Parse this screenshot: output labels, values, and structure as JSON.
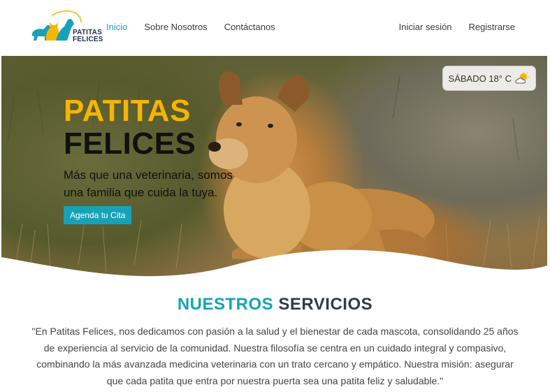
{
  "brand": {
    "logo_line1": "PATITAS",
    "logo_line2": "FELICES",
    "color_primary": "#17a2b8",
    "color_accent": "#f7b500"
  },
  "nav": {
    "left": [
      {
        "label": "Inicio",
        "active": true
      },
      {
        "label": "Sobre Nosotros",
        "active": false
      },
      {
        "label": "Contáctanos",
        "active": false
      }
    ],
    "right": [
      {
        "label": "Iniciar sesión"
      },
      {
        "label": "Registrarse"
      }
    ]
  },
  "weather": {
    "text": "SÁBADO 18° C",
    "icon": "partly-cloudy-icon"
  },
  "hero": {
    "title_line1": "PATITAS",
    "title_line2": "FELICES",
    "subtitle": "Más que una veterinaria, somos una familia que cuida la tuya.",
    "cta_label": "Agenda tu Cita"
  },
  "services": {
    "title_part1": "NUESTROS",
    "title_part2": "SERVICIOS",
    "description": "\"En Patitas Felices, nos dedicamos con pasión a la salud y el bienestar de cada mascota, consolidando 25 años de experiencia al servicio de la comunidad. Nuestra filosofía se centra en un cuidado integral y compasivo, combinando la más avanzada medicina veterinaria con un trato cercano y empático. Nuestra misión: asegurar que cada patita que entra por nuestra puerta sea una patita feliz y saludable.\""
  }
}
